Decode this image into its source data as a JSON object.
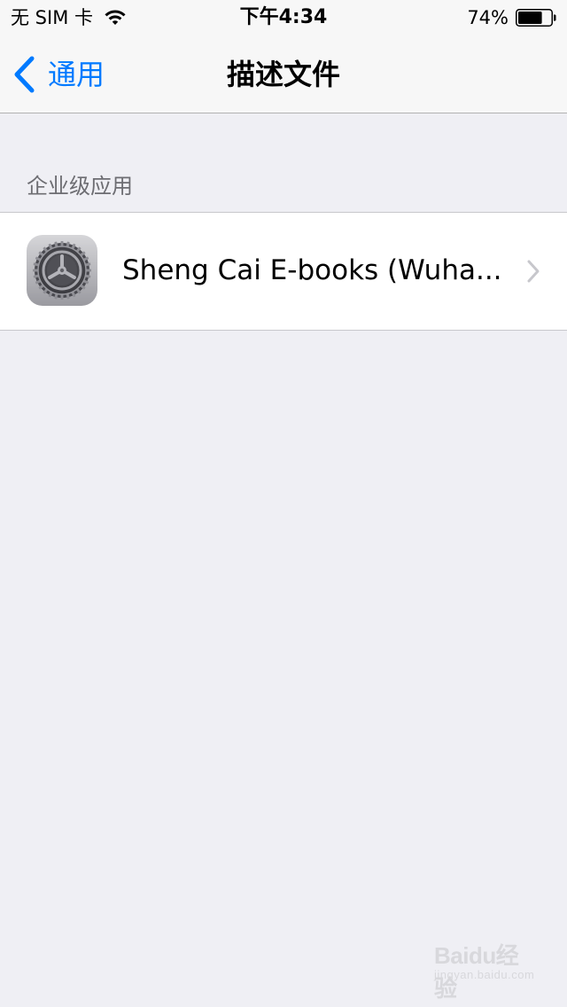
{
  "status_bar": {
    "carrier": "无 SIM 卡",
    "time": "下午4:34",
    "battery_percent_label": "74%",
    "battery_level": 0.74
  },
  "nav_bar": {
    "back_label": "通用",
    "title": "描述文件"
  },
  "section": {
    "header": "企业级应用",
    "items": [
      {
        "icon": "settings-gear-icon",
        "title": "Sheng Cai E-books (Wuha..."
      }
    ]
  },
  "watermark": {
    "brand": "Baidu经验",
    "sub": "jingyan.baidu.com"
  },
  "colors": {
    "accent": "#007AFF",
    "background": "#EFEFF4",
    "section_text": "#6D6D72",
    "separator": "#C8C7CC",
    "chevron": "#C7C7CC"
  }
}
